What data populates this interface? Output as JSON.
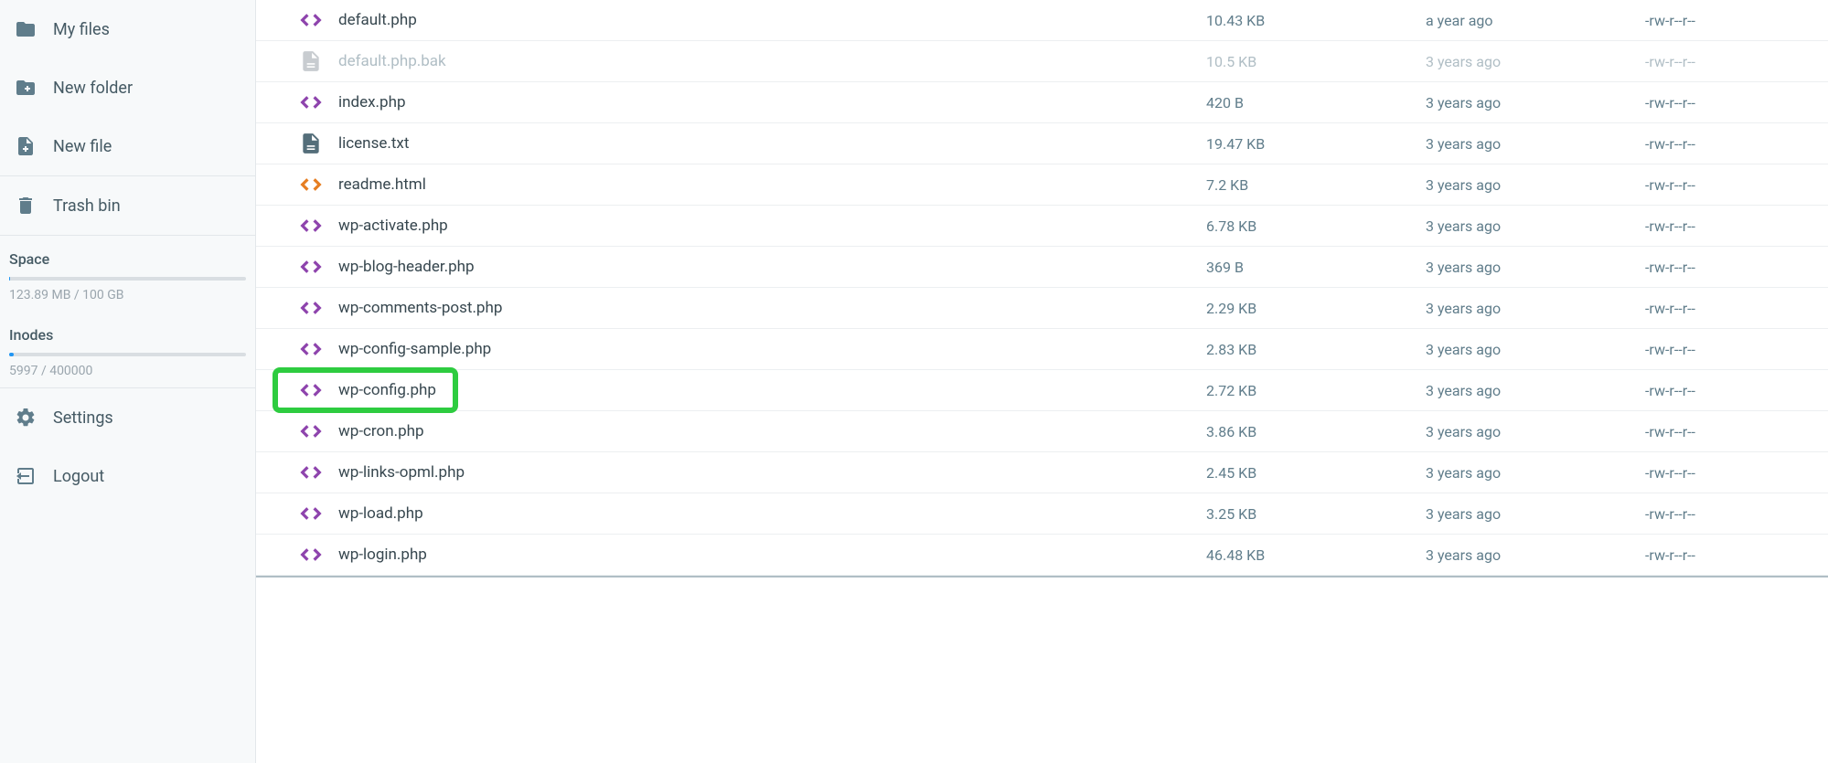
{
  "sidebar": {
    "my_files": "My files",
    "new_folder": "New folder",
    "new_file": "New file",
    "trash_bin": "Trash bin",
    "space_label": "Space",
    "space_stat": "123.89 MB / 100 GB",
    "space_fill_percent": 0.2,
    "inodes_label": "Inodes",
    "inodes_stat": "5997 / 400000",
    "inodes_fill_percent": 2,
    "settings": "Settings",
    "logout": "Logout"
  },
  "files": [
    {
      "name": "default.php",
      "size": "10.43 KB",
      "modified": "a year ago",
      "perm": "-rw-r--r--",
      "icon": "code-purple"
    },
    {
      "name": "default.php.bak",
      "size": "10.5 KB",
      "modified": "3 years ago",
      "perm": "-rw-r--r--",
      "icon": "file-light",
      "dim": true
    },
    {
      "name": "index.php",
      "size": "420 B",
      "modified": "3 years ago",
      "perm": "-rw-r--r--",
      "icon": "code-purple"
    },
    {
      "name": "license.txt",
      "size": "19.47 KB",
      "modified": "3 years ago",
      "perm": "-rw-r--r--",
      "icon": "file-gray"
    },
    {
      "name": "readme.html",
      "size": "7.2 KB",
      "modified": "3 years ago",
      "perm": "-rw-r--r--",
      "icon": "code-orange"
    },
    {
      "name": "wp-activate.php",
      "size": "6.78 KB",
      "modified": "3 years ago",
      "perm": "-rw-r--r--",
      "icon": "code-purple"
    },
    {
      "name": "wp-blog-header.php",
      "size": "369 B",
      "modified": "3 years ago",
      "perm": "-rw-r--r--",
      "icon": "code-purple"
    },
    {
      "name": "wp-comments-post.php",
      "size": "2.29 KB",
      "modified": "3 years ago",
      "perm": "-rw-r--r--",
      "icon": "code-purple"
    },
    {
      "name": "wp-config-sample.php",
      "size": "2.83 KB",
      "modified": "3 years ago",
      "perm": "-rw-r--r--",
      "icon": "code-purple"
    },
    {
      "name": "wp-config.php",
      "size": "2.72 KB",
      "modified": "3 years ago",
      "perm": "-rw-r--r--",
      "icon": "code-purple",
      "highlight": true
    },
    {
      "name": "wp-cron.php",
      "size": "3.86 KB",
      "modified": "3 years ago",
      "perm": "-rw-r--r--",
      "icon": "code-purple"
    },
    {
      "name": "wp-links-opml.php",
      "size": "2.45 KB",
      "modified": "3 years ago",
      "perm": "-rw-r--r--",
      "icon": "code-purple"
    },
    {
      "name": "wp-load.php",
      "size": "3.25 KB",
      "modified": "3 years ago",
      "perm": "-rw-r--r--",
      "icon": "code-purple"
    },
    {
      "name": "wp-login.php",
      "size": "46.48 KB",
      "modified": "3 years ago",
      "perm": "-rw-r--r--",
      "icon": "code-purple"
    }
  ]
}
